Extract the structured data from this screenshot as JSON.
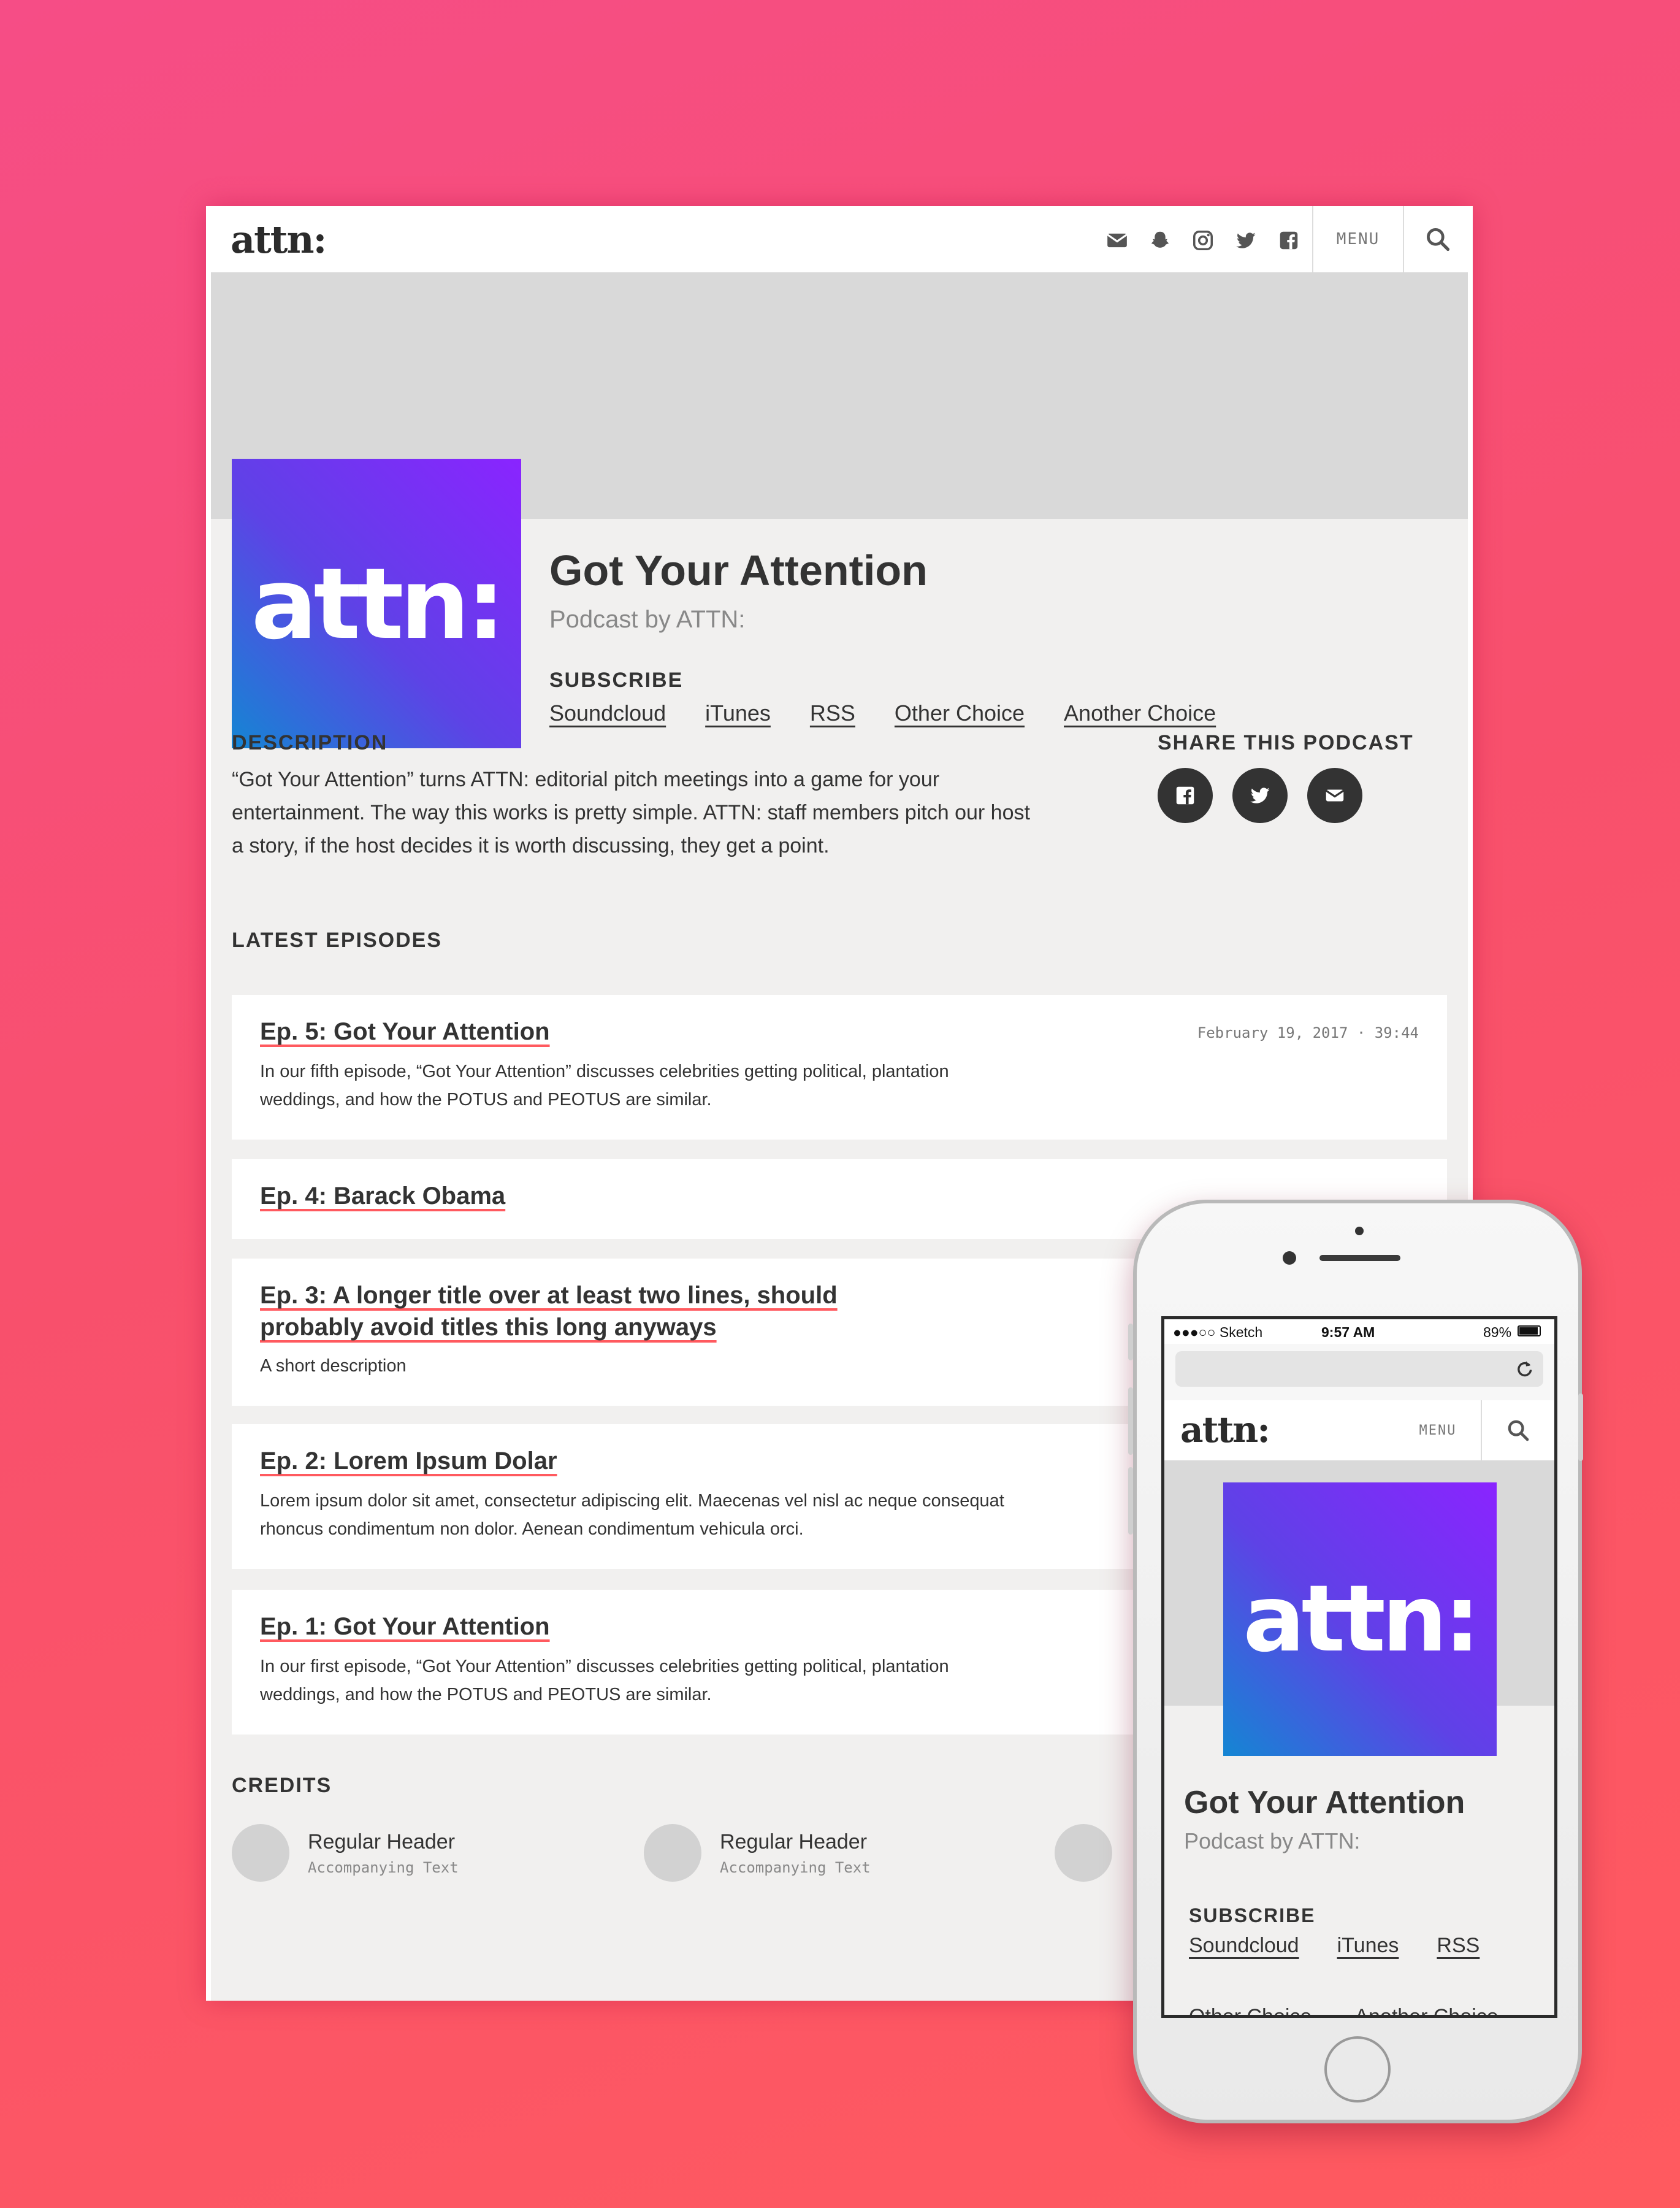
{
  "brand": "attn:",
  "nav": {
    "menu_label": "MENU",
    "social_icons": [
      "email-icon",
      "snapchat-icon",
      "instagram-icon",
      "twitter-icon",
      "facebook-icon"
    ]
  },
  "podcast": {
    "title": "Got Your Attention",
    "subtitle": "Podcast by ATTN:",
    "art_text": "attn:",
    "subscribe_heading": "SUBSCRIBE",
    "subscribe_links": [
      "Soundcloud",
      "iTunes",
      "RSS",
      "Other Choice",
      "Another Choice"
    ]
  },
  "description": {
    "heading": "DESCRIPTION",
    "text": "“Got Your Attention” turns ATTN: editorial pitch meetings into a game for your entertainment. The way this works is pretty simple. ATTN: staff members pitch our host a story, if the host decides it is worth discussing, they get a point."
  },
  "share": {
    "heading": "SHARE THIS PODCAST",
    "buttons": [
      "facebook-icon",
      "twitter-icon",
      "email-icon"
    ]
  },
  "episodes": {
    "heading": "LATEST EPISODES",
    "items": [
      {
        "title": "Ep. 5: Got Your Attention",
        "description": "In our fifth episode, “Got Your Attention” discusses celebrities getting political, plantation weddings, and how the POTUS and PEOTUS are similar.",
        "meta": "February 19, 2017 · 39:44"
      },
      {
        "title": "Ep. 4: Barack Obama",
        "description": "",
        "meta": ""
      },
      {
        "title": "Ep. 3: A longer title over at least two lines, should probably avoid titles this long anyways",
        "description": "A short description",
        "meta": ""
      },
      {
        "title": "Ep. 2: Lorem Ipsum Dolar",
        "description": "Lorem ipsum dolor sit amet, consectetur adipiscing elit. Maecenas vel nisl ac neque consequat rhoncus condimentum non dolor. Aenean condimentum vehicula orci.",
        "meta": ""
      },
      {
        "title": "Ep. 1: Got Your Attention",
        "description": "In our first episode, “Got Your Attention” discusses celebrities getting political, plantation weddings, and how the POTUS and PEOTUS are similar.",
        "meta": ""
      }
    ]
  },
  "credits": {
    "heading": "CREDITS",
    "items": [
      {
        "name": "Regular Header",
        "sub": "Accompanying Text"
      },
      {
        "name": "Regular Header",
        "sub": "Accompanying Text"
      }
    ]
  },
  "phone": {
    "status": {
      "carrier": "●●●○○ Sketch",
      "time": "9:57 AM",
      "battery": "89%"
    },
    "menu_label": "MENU",
    "brand": "attn:",
    "title": "Got Your Attention",
    "subtitle": "Podcast by ATTN:",
    "subscribe_heading": "SUBSCRIBE",
    "subscribe_links": [
      "Soundcloud",
      "iTunes",
      "RSS"
    ],
    "subscribe_links_cut": [
      "Other Choice",
      "Another Choice"
    ]
  },
  "colors": {
    "accent_underline": "#ff5a5f",
    "art_gradient_start": "#1486d3",
    "art_gradient_end": "#8a24ff",
    "background_start": "#f64d86",
    "background_end": "#ff5a5f"
  }
}
